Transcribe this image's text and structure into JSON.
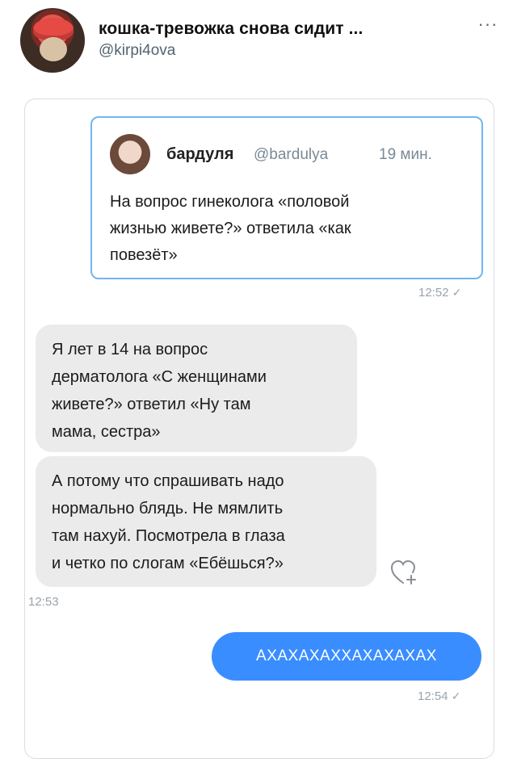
{
  "author": {
    "display_name": "кошка-тревожка снова сидит ...",
    "handle": "@kirpi4ova",
    "more": "···"
  },
  "quoted_tweet": {
    "name": "бардуля",
    "handle": "@bardulya",
    "time": "19 мин.",
    "text_lines": [
      "На вопрос гинеколога «половой",
      "жизнью живете?» ответила «как",
      "повезёт»"
    ]
  },
  "chat": {
    "time_1": "12:52",
    "incoming_1": [
      "Я лет в 14 на вопрос",
      "дерматолога «С женщинами",
      "живете?» ответил «Ну там",
      "мама, сестра»"
    ],
    "incoming_2": [
      "А потому что спрашивать надо",
      "нормально блядь. Не мямлить",
      "там нахуй. Посмотрела в глаза",
      "и четко по слогам «Ебёшься?»"
    ],
    "time_2": "12:53",
    "outgoing_1": "АХАХАХАХХАХАХАХАХ",
    "time_3": "12:54",
    "check_mark": "✓"
  },
  "colors": {
    "outgoing_bubble": "#3a8dff",
    "incoming_bubble": "#ebebec",
    "quote_border": "#72b5ef"
  }
}
